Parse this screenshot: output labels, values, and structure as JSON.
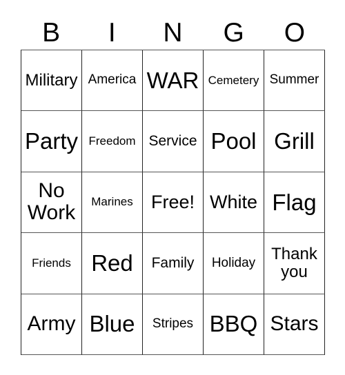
{
  "card": {
    "title_letters": [
      "B",
      "I",
      "N",
      "G",
      "O"
    ],
    "grid_background": "#ffffff",
    "line_color": "#222222",
    "text_color": "#000000",
    "columns": 5,
    "rows": 5,
    "cells": [
      {
        "label": "Military",
        "size": "ml",
        "column": "B",
        "row": 1
      },
      {
        "label": "America",
        "size": "sm",
        "column": "I",
        "row": 1
      },
      {
        "label": "WAR",
        "size": "xxl",
        "column": "N",
        "row": 1
      },
      {
        "label": "Cemetery",
        "size": "s",
        "column": "G",
        "row": 1
      },
      {
        "label": "Summer",
        "size": "sm",
        "column": "O",
        "row": 1
      },
      {
        "label": "Party",
        "size": "xxl",
        "column": "B",
        "row": 2
      },
      {
        "label": "Freedom",
        "size": "s",
        "column": "I",
        "row": 2
      },
      {
        "label": "Service",
        "size": "m",
        "column": "N",
        "row": 2
      },
      {
        "label": "Pool",
        "size": "xxl",
        "column": "G",
        "row": 2
      },
      {
        "label": "Grill",
        "size": "xxl",
        "column": "O",
        "row": 2
      },
      {
        "label": "No Work",
        "size": "xl",
        "column": "B",
        "row": 3
      },
      {
        "label": "Marines",
        "size": "s",
        "column": "I",
        "row": 3
      },
      {
        "label": "Free!",
        "size": "l",
        "column": "N",
        "row": 3
      },
      {
        "label": "White",
        "size": "l",
        "column": "G",
        "row": 3
      },
      {
        "label": "Flag",
        "size": "xxl",
        "column": "O",
        "row": 3
      },
      {
        "label": "Friends",
        "size": "s",
        "column": "B",
        "row": 4
      },
      {
        "label": "Red",
        "size": "xxl",
        "column": "I",
        "row": 4
      },
      {
        "label": "Family",
        "size": "m",
        "column": "N",
        "row": 4
      },
      {
        "label": "Holiday",
        "size": "sm",
        "column": "G",
        "row": 4
      },
      {
        "label": "Thank you",
        "size": "ml",
        "column": "O",
        "row": 4
      },
      {
        "label": "Army",
        "size": "xl",
        "column": "B",
        "row": 5
      },
      {
        "label": "Blue",
        "size": "xxl",
        "column": "I",
        "row": 5
      },
      {
        "label": "Stripes",
        "size": "sm",
        "column": "N",
        "row": 5
      },
      {
        "label": "BBQ",
        "size": "xxl",
        "column": "G",
        "row": 5
      },
      {
        "label": "Stars",
        "size": "xl",
        "column": "O",
        "row": 5
      }
    ]
  }
}
